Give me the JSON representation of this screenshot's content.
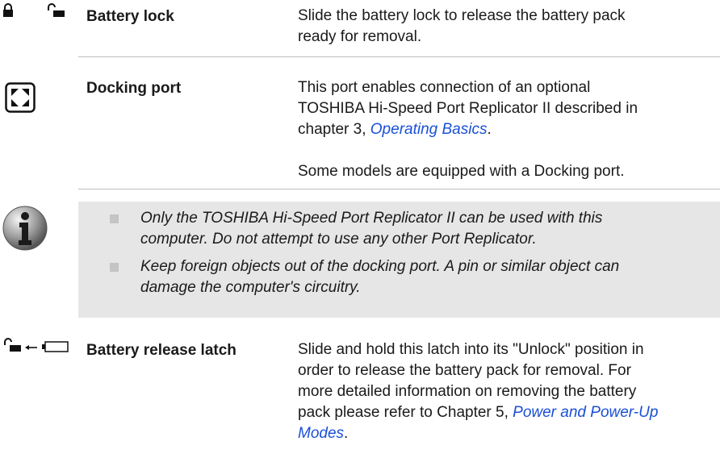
{
  "battery_lock": {
    "term": "Battery lock",
    "desc": "Slide the battery lock to release the battery pack ready for removal.",
    "icons": [
      "closed-padlock-icon",
      "open-padlock-icon"
    ]
  },
  "docking_port": {
    "term": "Docking port",
    "desc_prefix": "This port enables connection of an optional TOSHIBA Hi-Speed Port Replicator II described in chapter 3, ",
    "link": "Operating Basics",
    "desc_suffix": ".",
    "desc2": "Some models are equipped with a Docking port.",
    "icon": "docking-port-icon"
  },
  "note": {
    "icon": "info-icon",
    "items": [
      "Only the TOSHIBA Hi-Speed Port Replicator II can be used with this computer. Do not attempt to use any other Port Replicator.",
      "Keep foreign objects out of the docking port. A pin or similar object can damage the computer's circuitry."
    ]
  },
  "battery_release_latch": {
    "term": "Battery release latch",
    "desc_prefix": "Slide and hold this latch into its \"Unlock\" position in order to release the battery pack for removal. For more detailed information on removing the battery pack please refer to Chapter 5, ",
    "link": "Power and Power-Up Modes",
    "desc_suffix": ".",
    "icons": [
      "open-padlock-icon",
      "arrow-left-icon",
      "battery-outline-icon"
    ]
  },
  "colors": {
    "link": "#1a4fd6",
    "note_bg": "#e6e6e6",
    "bullet": "#c4c4c4",
    "rule": "#bdbdbd"
  }
}
